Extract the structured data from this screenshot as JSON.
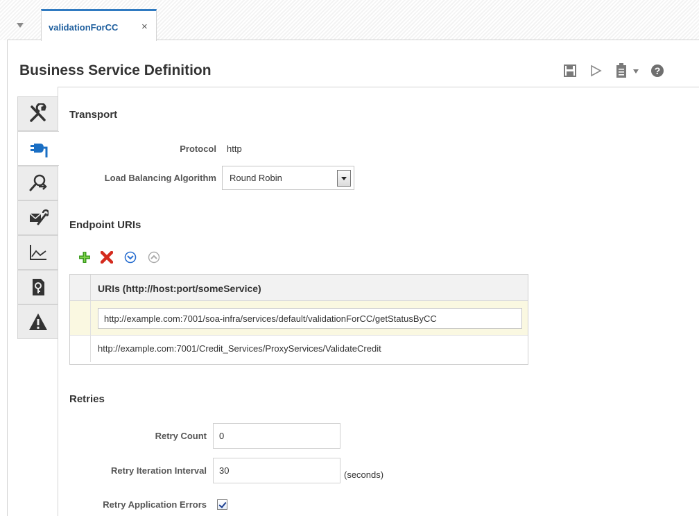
{
  "tab": {
    "label": "validationForCC",
    "close": "×"
  },
  "page": {
    "title": "Business Service Definition"
  },
  "toolbar": {
    "icons": [
      "save-icon",
      "run-icon",
      "clipboard-icon",
      "dropdown-icon",
      "help-icon"
    ],
    "help_glyph": "?"
  },
  "sidenav": {
    "items": [
      {
        "icon": "tools-icon"
      },
      {
        "icon": "transport-plug-icon",
        "active": true
      },
      {
        "icon": "search-user-icon"
      },
      {
        "icon": "message-handling-icon"
      },
      {
        "icon": "performance-chart-icon"
      },
      {
        "icon": "security-key-icon"
      },
      {
        "icon": "warning-icon",
        "glyph": "!"
      }
    ]
  },
  "transport": {
    "heading": "Transport",
    "protocol_label": "Protocol",
    "protocol_value": "http",
    "lb_label": "Load Balancing Algorithm",
    "lb_value": "Round Robin"
  },
  "endpoints": {
    "heading": "Endpoint URIs",
    "tools": [
      "add-icon",
      "delete-icon",
      "move-down-icon",
      "move-up-icon"
    ],
    "column_header": "URIs (http://host:port/someService)",
    "rows": [
      "http://example.com:7001/soa-infra/services/default/validationForCC/getStatusByCC",
      "http://example.com:7001/Credit_Services/ProxyServices/ValidateCredit"
    ]
  },
  "retries": {
    "heading": "Retries",
    "count_label": "Retry Count",
    "count_value": "0",
    "interval_label": "Retry Iteration Interval",
    "interval_value": "30",
    "interval_unit": "(seconds)",
    "app_errors_label": "Retry Application Errors",
    "app_errors_checked": true
  },
  "colors": {
    "accent": "#2f7ac1",
    "add": "#3a9a1e",
    "delete": "#d42b1e",
    "move": "#2a6fd0"
  }
}
